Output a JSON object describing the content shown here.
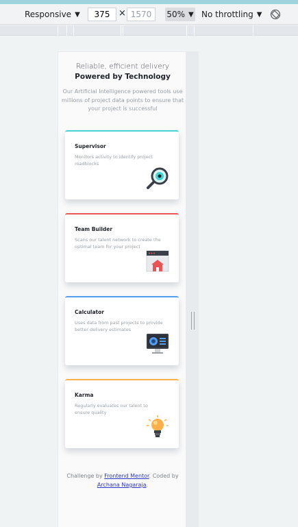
{
  "devtools": {
    "device_label": "Responsive",
    "width_value": "375",
    "times_sign": "×",
    "height_value": "1570",
    "zoom_label": "50%",
    "throttle_label": "No throttling"
  },
  "hero": {
    "subtitle": "Reliable, efficient delivery",
    "title": "Powered by Technology",
    "description": "Our Artificial Intelligence powered tools use millions of project data points to ensure that your project is successful"
  },
  "cards": [
    {
      "title": "Supervisor",
      "description": "Monitors activity to identify project roadblocks",
      "accent": "#44d3d2",
      "icon": "magnifier-icon"
    },
    {
      "title": "Team Builder",
      "description": "Scans our talent network to create the optimal team for your project",
      "accent": "#ea5454",
      "icon": "team-builder-icon"
    },
    {
      "title": "Calculator",
      "description": "Uses data from past projects to provide better delivery estimates",
      "accent": "#549ef2",
      "icon": "calculator-icon"
    },
    {
      "title": "Karma",
      "description": "Regularly evaluates our talent to ensure quality",
      "accent": "#fcaf4a",
      "icon": "lightbulb-icon"
    }
  ],
  "footer": {
    "prefix": "Challenge by ",
    "link1": "Frontend Mentor",
    "middle": ". Coded by ",
    "link2": "Archana Nagaraja",
    "suffix": "."
  }
}
